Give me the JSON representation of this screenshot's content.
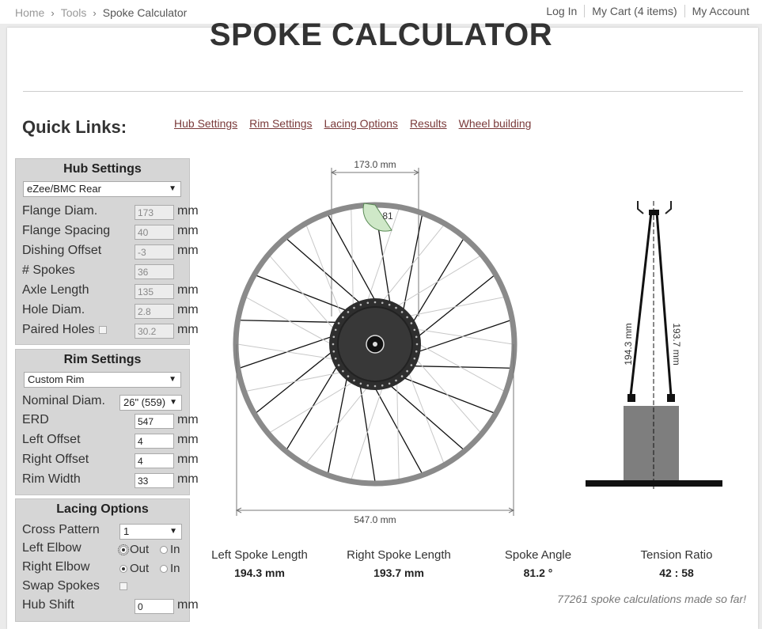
{
  "breadcrumb": {
    "home": "Home",
    "tools": "Tools",
    "current": "Spoke Calculator"
  },
  "top_links": {
    "login": "Log In",
    "cart": "My Cart (4 items)",
    "account": "My Account"
  },
  "title": "SPOKE CALCULATOR",
  "quick_links": {
    "label": "Quick Links:",
    "items": [
      "Hub Settings",
      "Rim Settings",
      "Lacing Options",
      "Results",
      "Wheel building"
    ]
  },
  "hub": {
    "heading": "Hub Settings",
    "model": "eZee/BMC Rear",
    "fields": [
      {
        "label": "Flange Diam.",
        "value": "173",
        "unit": "mm"
      },
      {
        "label": "Flange Spacing",
        "value": "40",
        "unit": "mm"
      },
      {
        "label": "Dishing Offset",
        "value": "-3",
        "unit": "mm"
      },
      {
        "label": "# Spokes",
        "value": "36",
        "unit": ""
      },
      {
        "label": "Axle Length",
        "value": "135",
        "unit": "mm"
      },
      {
        "label": "Hole Diam.",
        "value": "2.8",
        "unit": "mm"
      },
      {
        "label": "Paired Holes",
        "value": "30.2",
        "unit": "mm"
      }
    ]
  },
  "rim": {
    "heading": "Rim Settings",
    "model": "Custom Rim",
    "nominal": {
      "label": "Nominal Diam.",
      "value": "26\" (559)"
    },
    "fields": [
      {
        "label": "ERD",
        "value": "547",
        "unit": "mm"
      },
      {
        "label": "Left Offset",
        "value": "4",
        "unit": "mm"
      },
      {
        "label": "Right Offset",
        "value": "4",
        "unit": "mm"
      },
      {
        "label": "Rim Width",
        "value": "33",
        "unit": "mm"
      }
    ]
  },
  "lacing": {
    "heading": "Lacing Options",
    "cross": {
      "label": "Cross Pattern",
      "value": "1"
    },
    "left_elbow": {
      "label": "Left Elbow",
      "out": "Out",
      "in": "In",
      "selected": "Out"
    },
    "right_elbow": {
      "label": "Right Elbow",
      "out": "Out",
      "in": "In",
      "selected": "Out"
    },
    "swap": {
      "label": "Swap Spokes"
    },
    "shift": {
      "label": "Hub Shift",
      "value": "0",
      "unit": "mm"
    }
  },
  "diagram": {
    "flange_dim": "173.0 mm",
    "erd_dim": "547.0 mm",
    "angle": "81",
    "left_len": "194.3 mm",
    "right_len": "193.7 mm"
  },
  "results": [
    {
      "label": "Left Spoke Length",
      "value": "194.3 mm"
    },
    {
      "label": "Right Spoke Length",
      "value": "193.7 mm"
    },
    {
      "label": "Spoke Angle",
      "value": "81.2 °"
    },
    {
      "label": "Tension Ratio",
      "value": "42 : 58"
    }
  ],
  "counter": "77261 spoke calculations made so far!",
  "colors": {
    "link": "#7a3a3a",
    "panel": "#d6d6d6",
    "rim": "#8a8a8a",
    "hub": "#2e2e2e",
    "angle": "#cfe8c8"
  }
}
